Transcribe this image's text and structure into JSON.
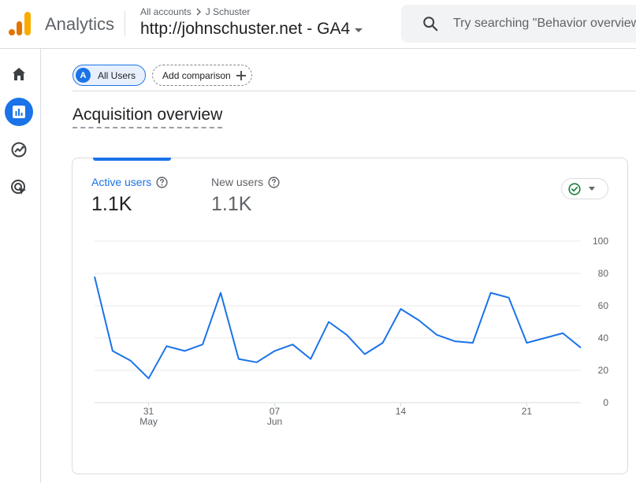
{
  "header": {
    "product_name": "Analytics",
    "breadcrumb": [
      "All accounts",
      "J Schuster"
    ],
    "property_name": "http://johnschuster.net - GA4",
    "search_placeholder": "Try searching \"Behavior overview\""
  },
  "nav": {
    "items": [
      {
        "icon": "home-icon",
        "active": false
      },
      {
        "icon": "reports-icon",
        "active": true
      },
      {
        "icon": "explore-icon",
        "active": false
      },
      {
        "icon": "advertising-icon",
        "active": false
      }
    ]
  },
  "comparison": {
    "all_users_avatar": "A",
    "all_users_label": "All Users",
    "add_comparison_label": "Add comparison"
  },
  "page": {
    "title": "Acquisition overview"
  },
  "card": {
    "metrics": [
      {
        "label": "Active users",
        "value": "1.1K",
        "selected": true
      },
      {
        "label": "New users",
        "value": "1.1K",
        "selected": false
      }
    ]
  },
  "colors": {
    "accent": "#1a73e8",
    "line": "#1a73e8",
    "grid": "#e8eaed",
    "check": "#188038"
  },
  "chart_data": {
    "type": "line",
    "series": [
      {
        "values": [
          78,
          32,
          26,
          15,
          35,
          32,
          36,
          68,
          27,
          25,
          32,
          36,
          27,
          50,
          42,
          30,
          37,
          58,
          51,
          42,
          38,
          37,
          68,
          65,
          37,
          40,
          43,
          34
        ]
      }
    ],
    "x_ticks": [
      {
        "index": 3,
        "day": "31",
        "month": "May"
      },
      {
        "index": 10,
        "day": "07",
        "month": "Jun"
      },
      {
        "index": 17,
        "day": "14",
        "month": ""
      },
      {
        "index": 24,
        "day": "21",
        "month": ""
      }
    ],
    "y_ticks": [
      "0",
      "20",
      "40",
      "60",
      "80",
      "100"
    ],
    "ylim": [
      0,
      100
    ],
    "grid": true
  }
}
